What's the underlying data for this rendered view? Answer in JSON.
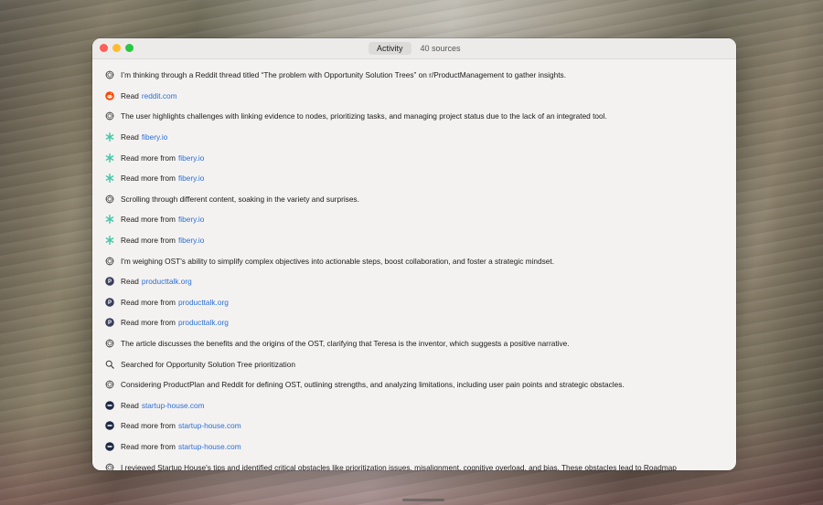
{
  "window": {
    "tabs": [
      {
        "label": "Activity",
        "active": true
      },
      {
        "label": "40 sources",
        "active": false
      }
    ]
  },
  "colors": {
    "link": "#2a6fd6",
    "reddit": "#ff4500",
    "fibery": "#47c7a8",
    "producttalk": "#3b3f5c",
    "startup": "#1f2a44"
  },
  "rows": [
    {
      "icon": "thought-icon",
      "text": "I’m thinking through a Reddit thread titled “The problem with Opportunity Solution Trees” on r/ProductManagement to gather insights.",
      "link": ""
    },
    {
      "icon": "reddit-icon",
      "text": "Read",
      "link": "reddit.com"
    },
    {
      "icon": "thought-icon",
      "text": "The user highlights challenges with linking evidence to nodes, prioritizing tasks, and managing project status due to the lack of an integrated tool.",
      "link": ""
    },
    {
      "icon": "fibery-icon",
      "text": "Read",
      "link": "fibery.io"
    },
    {
      "icon": "fibery-icon",
      "text": "Read more from",
      "link": "fibery.io"
    },
    {
      "icon": "fibery-icon",
      "text": "Read more from",
      "link": "fibery.io"
    },
    {
      "icon": "thought-icon",
      "text": "Scrolling through different content, soaking in the variety and surprises.",
      "link": ""
    },
    {
      "icon": "fibery-icon",
      "text": "Read more from",
      "link": "fibery.io"
    },
    {
      "icon": "fibery-icon",
      "text": "Read more from",
      "link": "fibery.io"
    },
    {
      "icon": "thought-icon",
      "text": "I'm weighing OST's ability to simplify complex objectives into actionable steps, boost collaboration, and foster a strategic mindset.",
      "link": ""
    },
    {
      "icon": "producttalk-icon",
      "text": "Read",
      "link": "producttalk.org"
    },
    {
      "icon": "producttalk-icon",
      "text": "Read more from",
      "link": "producttalk.org"
    },
    {
      "icon": "producttalk-icon",
      "text": "Read more from",
      "link": "producttalk.org"
    },
    {
      "icon": "thought-icon",
      "text": "The article discusses the benefits and the origins of the OST, clarifying that Teresa is the inventor, which suggests a positive narrative.",
      "link": ""
    },
    {
      "icon": "search-icon",
      "text": "Searched for Opportunity Solution Tree prioritization",
      "link": ""
    },
    {
      "icon": "thought-icon",
      "text": "Considering ProductPlan and Reddit for defining OST, outlining strengths, and analyzing limitations, including user pain points and strategic obstacles.",
      "link": ""
    },
    {
      "icon": "startup-icon",
      "text": "Read",
      "link": "startup-house.com"
    },
    {
      "icon": "startup-icon",
      "text": "Read more from",
      "link": "startup-house.com"
    },
    {
      "icon": "startup-icon",
      "text": "Read more from",
      "link": "startup-house.com"
    },
    {
      "icon": "thought-icon",
      "text": "I reviewed Startup House's tips and identified critical obstacles like prioritization issues, misalignment, cognitive overload, and bias. These obstacles lead to Roadmap",
      "link": ""
    }
  ]
}
